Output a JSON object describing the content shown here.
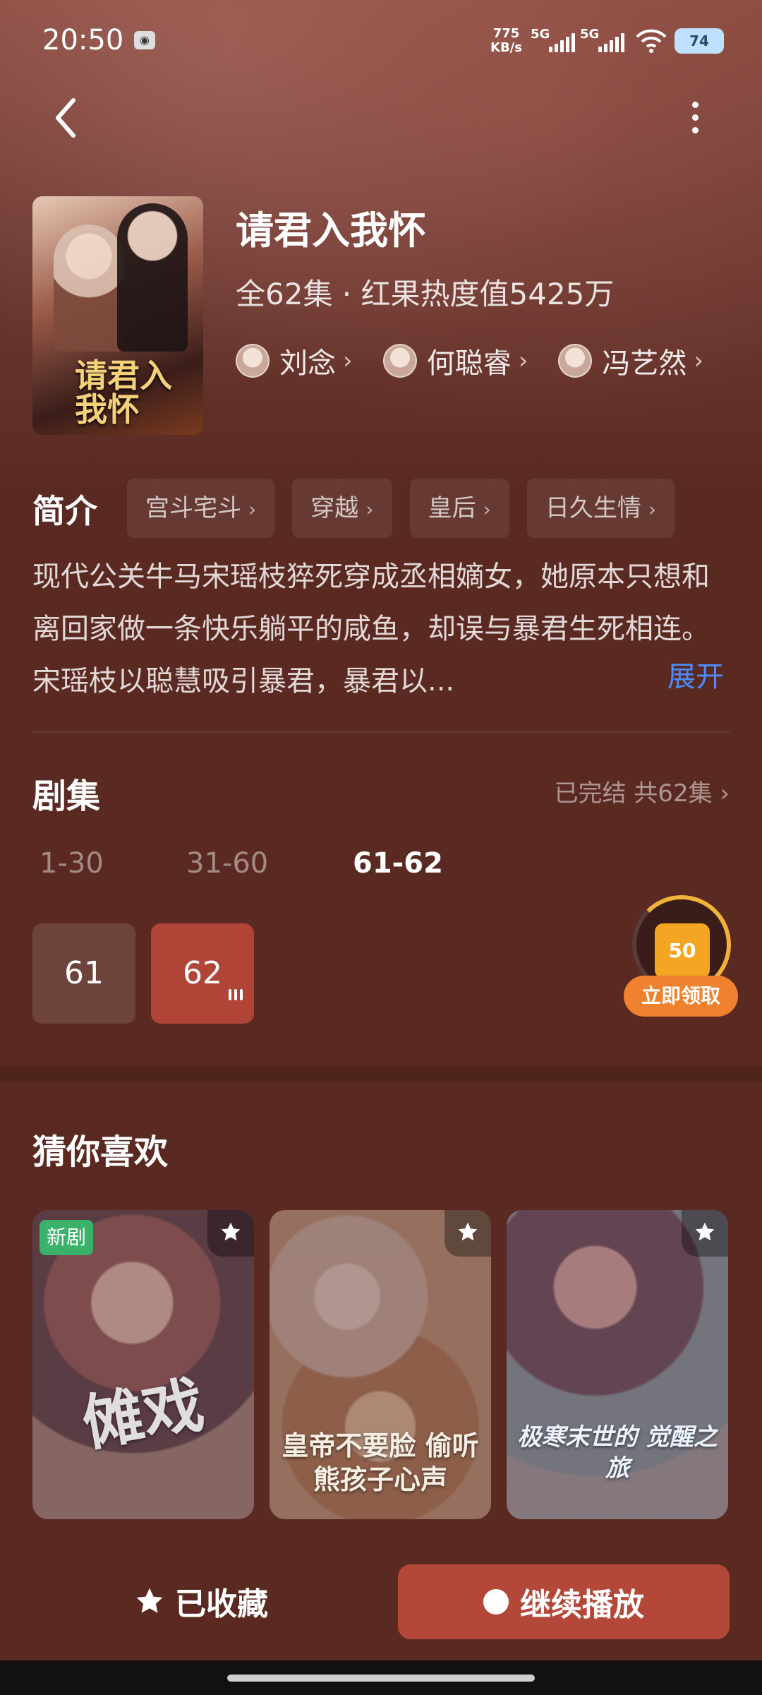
{
  "status_bar": {
    "time": "20:50",
    "speed_value": "775",
    "speed_unit": "KB/s",
    "network_1": "5G",
    "network_2": "5G",
    "battery": "74"
  },
  "drama": {
    "title": "请君入我怀",
    "meta": "全62集 · 红果热度值5425万",
    "poster_title": "请君入我怀",
    "cast": [
      {
        "name": "刘念"
      },
      {
        "name": "何聪睿"
      },
      {
        "name": "冯艺然"
      }
    ]
  },
  "synopsis": {
    "heading": "简介",
    "tags": [
      "宫斗宅斗",
      "穿越",
      "皇后",
      "日久生情"
    ],
    "text": "现代公关牛马宋瑶枝猝死穿成丞相嫡女，她原本只想和离回家做一条快乐躺平的咸鱼，却误与暴君生死相连。宋瑶枝以聪慧吸引暴君，暴君以...",
    "expand_label": "展开"
  },
  "episodes": {
    "heading": "剧集",
    "status": "已完结 共62集",
    "ranges": [
      "1-30",
      "31-60",
      "61-62"
    ],
    "active_range_index": 2,
    "items": [
      "61",
      "62"
    ],
    "playing_index": 1
  },
  "reward": {
    "amount": "50",
    "button_label": "立即领取"
  },
  "recommend": {
    "heading": "猜你喜欢",
    "cards": [
      {
        "title": "傩戏",
        "badge": "新剧"
      },
      {
        "title": "皇帝不要脸 偷听熊孩子心声",
        "badge": ""
      },
      {
        "title": "极寒末世的 觉醒之旅",
        "badge": ""
      }
    ]
  },
  "bottom": {
    "collect_label": "已收藏",
    "play_label": "继续播放"
  },
  "colors": {
    "background": "#5a2a22",
    "accent": "#b44838",
    "link": "#4c8cff",
    "reward": "#f0812e",
    "new_badge": "#3ab26a"
  }
}
